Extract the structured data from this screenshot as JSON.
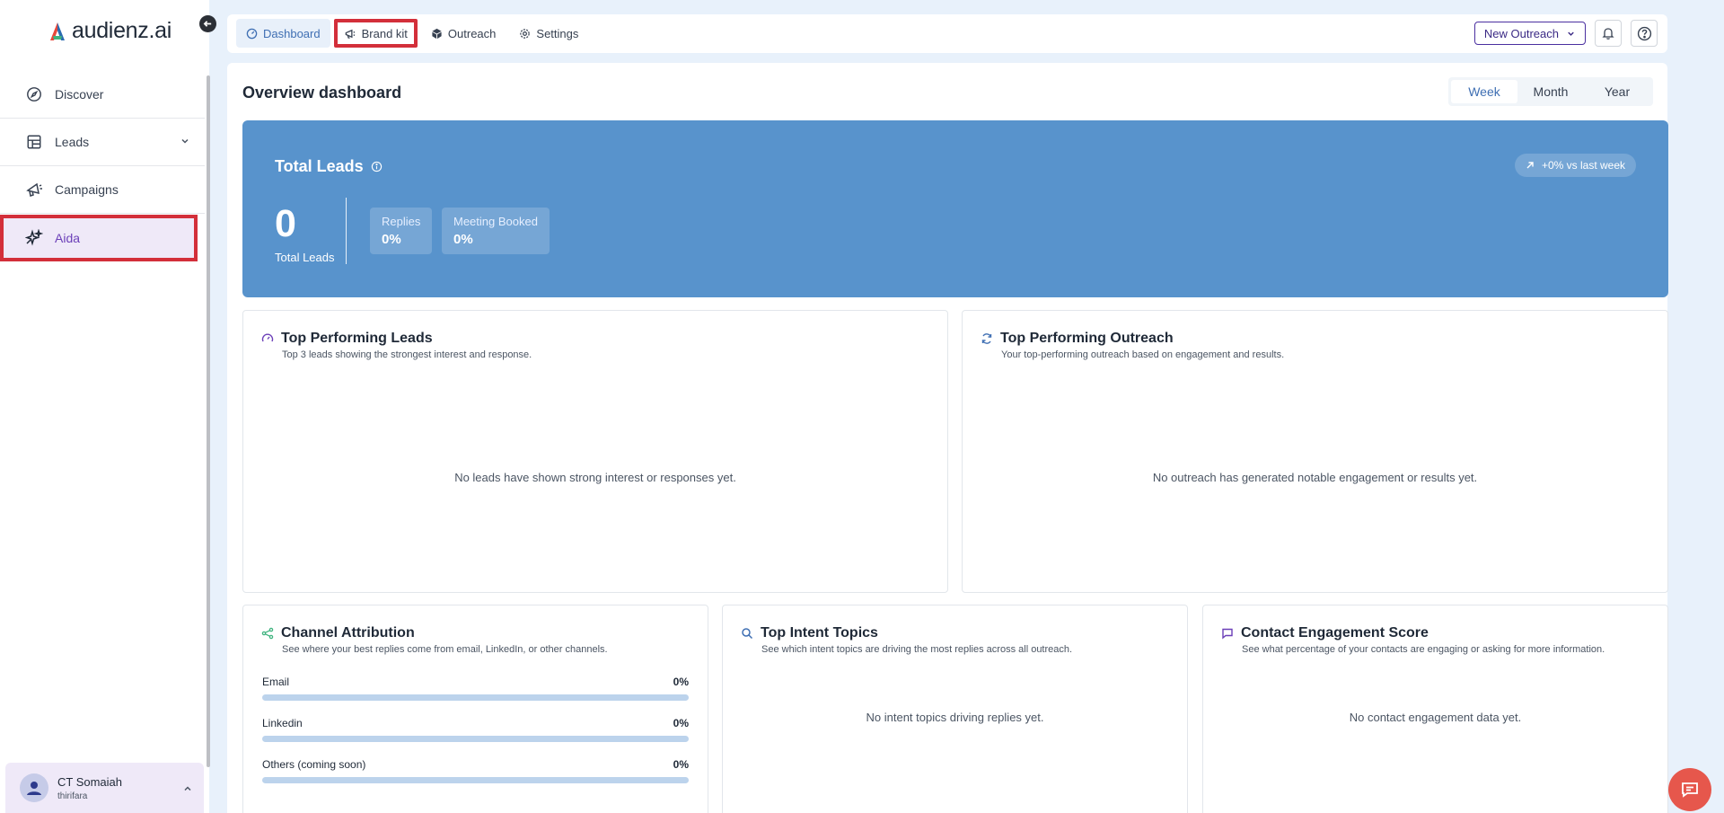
{
  "sidebar": {
    "logo_text": "audienz.ai",
    "items": [
      {
        "label": "Discover"
      },
      {
        "label": "Leads"
      },
      {
        "label": "Campaigns"
      },
      {
        "label": "Aida"
      }
    ],
    "user": {
      "name": "CT Somaiah",
      "sub": "thirifara"
    }
  },
  "topbar": {
    "tabs": [
      {
        "label": "Dashboard"
      },
      {
        "label": "Brand kit"
      },
      {
        "label": "Outreach"
      },
      {
        "label": "Settings"
      }
    ],
    "new_outreach_label": "New Outreach"
  },
  "main": {
    "title": "Overview dashboard",
    "periods": [
      "Week",
      "Month",
      "Year"
    ],
    "selected_period": "Week",
    "hero": {
      "title": "Total Leads",
      "badge": "+0% vs last week",
      "total_value": "0",
      "total_label": "Total Leads",
      "stats": [
        {
          "label": "Replies",
          "value": "0%"
        },
        {
          "label": "Meeting Booked",
          "value": "0%"
        }
      ]
    },
    "top_leads": {
      "title": "Top Performing Leads",
      "subtitle": "Top 3 leads showing the strongest interest and response.",
      "empty": "No leads have shown strong interest or responses yet."
    },
    "top_outreach": {
      "title": "Top Performing Outreach",
      "subtitle": "Your top-performing outreach based on engagement and results.",
      "empty": "No outreach has generated notable engagement or results yet."
    },
    "channel_attribution": {
      "title": "Channel Attribution",
      "subtitle": "See where your best replies come from email, LinkedIn, or other channels.",
      "channels": [
        {
          "label": "Email",
          "value": "0%",
          "fraction": 0
        },
        {
          "label": "Linkedin",
          "value": "0%",
          "fraction": 0
        },
        {
          "label": "Others (coming soon)",
          "value": "0%",
          "fraction": 0
        }
      ]
    },
    "intent_topics": {
      "title": "Top Intent Topics",
      "subtitle": "See which intent topics are driving the most replies across all outreach.",
      "empty": "No intent topics driving replies yet."
    },
    "engagement": {
      "title": "Contact Engagement Score",
      "subtitle": "See what percentage of your contacts are engaging or asking for more information.",
      "empty": "No contact engagement data yet."
    }
  },
  "colors": {
    "accent_blue": "#5893cc",
    "highlight_red": "#d32f3a",
    "active_purple": "#6b3fb8",
    "chat_fab": "#e6574c"
  },
  "icons": {
    "discover": "compass-icon",
    "leads": "table-icon",
    "campaigns": "megaphone-icon",
    "aida": "sparkles-icon",
    "notifications": "bell-icon",
    "help": "help-circle-icon",
    "chat": "chat-icon"
  }
}
